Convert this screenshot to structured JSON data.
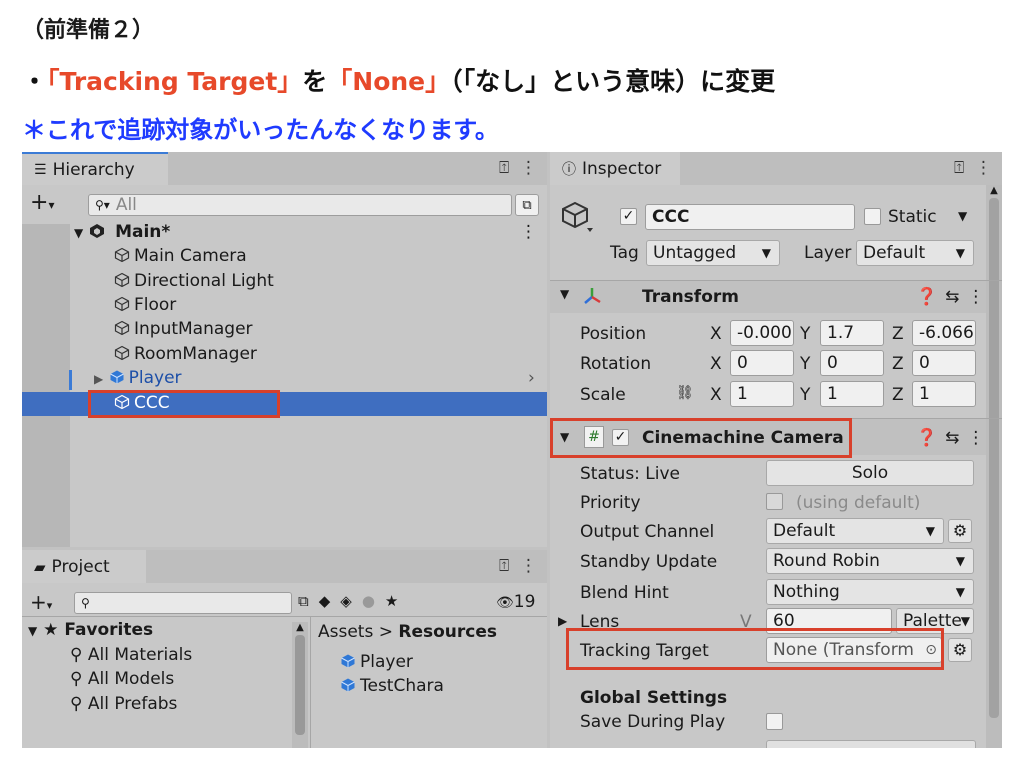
{
  "instructions": {
    "line1": "（前準備２）",
    "line2_bullet": "・",
    "line2_target": "「Tracking Target」",
    "line2_wo": "を",
    "line2_none": "「None」",
    "line2_rest": "（「なし」という意味）に変更",
    "line3": "＊これで追跡対象がいったんなくなります。"
  },
  "colors": {
    "accent_red": "#e7492a",
    "note_blue": "#1f3bff",
    "selection": "#3f6ec0",
    "highlight_box": "#d8402b"
  },
  "hierarchy": {
    "tab_label": "Hierarchy",
    "search_placeholder": "All",
    "scene": "Main*",
    "items": [
      {
        "label": "Main Camera"
      },
      {
        "label": "Directional Light"
      },
      {
        "label": "Floor"
      },
      {
        "label": "InputManager"
      },
      {
        "label": "RoomManager"
      },
      {
        "label": "Player"
      },
      {
        "label": "CCC"
      }
    ]
  },
  "project": {
    "tab_label": "Project",
    "count": "19",
    "favorites_label": "Favorites",
    "favorites": [
      "All Materials",
      "All Models",
      "All Prefabs"
    ],
    "breadcrumb_root": "Assets",
    "breadcrumb_sep": ">",
    "breadcrumb_current": "Resources",
    "assets": [
      "Player",
      "TestChara"
    ]
  },
  "inspector": {
    "tab_label": "Inspector",
    "object_name": "CCC",
    "static_label": "Static",
    "tag_label": "Tag",
    "tag_value": "Untagged",
    "layer_label": "Layer",
    "layer_value": "Default",
    "transform": {
      "title": "Transform",
      "position_label": "Position",
      "rotation_label": "Rotation",
      "scale_label": "Scale",
      "x": "X",
      "y": "Y",
      "z": "Z",
      "position": [
        "-0.000",
        "1.7",
        "-6.066"
      ],
      "rotation": [
        "0",
        "0",
        "0"
      ],
      "scale": [
        "1",
        "1",
        "1"
      ]
    },
    "cinemachine": {
      "title": "Cinemachine Camera",
      "status_label": "Status: Live",
      "solo_label": "Solo",
      "priority_label": "Priority",
      "priority_value": "(using default)",
      "output_label": "Output Channel",
      "output_value": "Default",
      "standby_label": "Standby Update",
      "standby_value": "Round Robin",
      "blend_label": "Blend Hint",
      "blend_value": "Nothing",
      "lens_label": "Lens",
      "lens_v": "V",
      "lens_value": "60",
      "lens_palette": "Palette",
      "tracking_label": "Tracking Target",
      "tracking_value": "None (Transform",
      "global_label": "Global Settings",
      "save_label": "Save During Play"
    }
  }
}
